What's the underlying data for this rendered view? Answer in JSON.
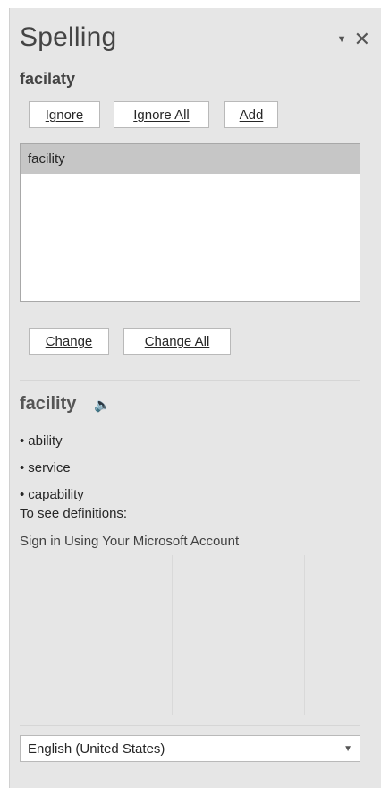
{
  "pane": {
    "title": "Spelling",
    "misspelled_word": "facilaty"
  },
  "controls": {
    "options_icon": "dropdown-arrow-icon",
    "close_icon": "close-icon",
    "options_glyph": "▼",
    "close_glyph": "✕"
  },
  "buttons": {
    "ignore": "Ignore",
    "ignore_all": "Ignore All",
    "add": "Add",
    "change": "Change",
    "change_all": "Change All"
  },
  "suggestions": {
    "items": [
      "facility"
    ],
    "selected": "facility"
  },
  "definition": {
    "word": "facility",
    "speaker_icon": "speaker-icon",
    "speaker_glyph": "🔈",
    "synonyms": [
      "ability",
      "service",
      "capability"
    ],
    "bullet": "•",
    "see_definitions": "To see definitions:",
    "signin": "Sign in Using Your Microsoft Account"
  },
  "language": {
    "selected": "English (United States)",
    "arrow_glyph": "▼"
  }
}
